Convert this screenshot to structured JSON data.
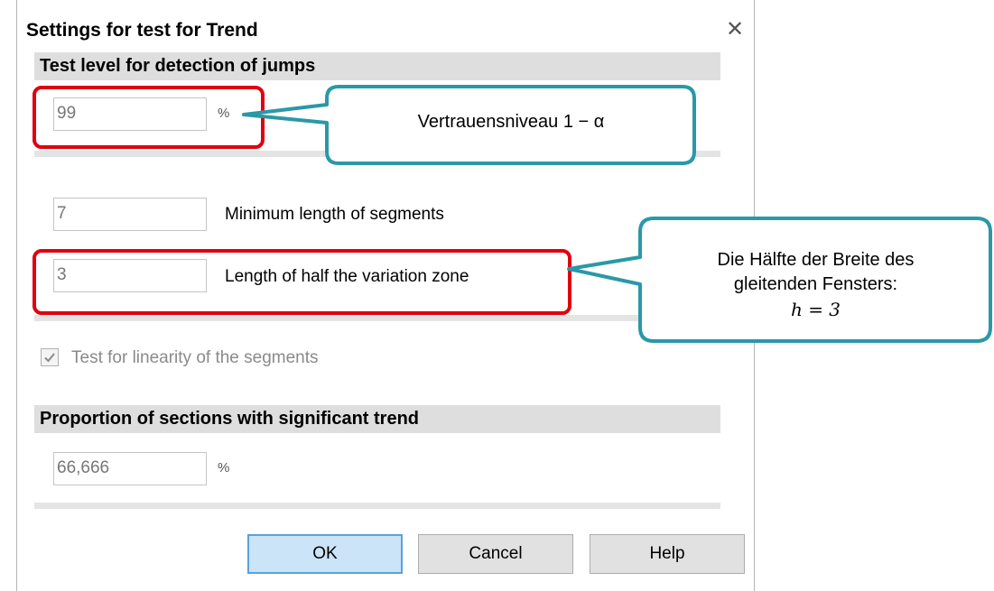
{
  "dialog": {
    "title": "Settings for test for Trend",
    "close_glyph": "✕"
  },
  "jump_section": {
    "header": "Test level for detection of jumps",
    "level_value": "99",
    "level_unit": "%"
  },
  "segments": {
    "min_length_value": "7",
    "min_length_label": "Minimum length of segments",
    "half_zone_value": "3",
    "half_zone_label": "Length of half the variation zone"
  },
  "linearity": {
    "label": "Test for linearity of the segments",
    "checked": true
  },
  "trend_section": {
    "header": "Proportion of sections with significant trend",
    "proportion_value": "66,666",
    "proportion_unit": "%"
  },
  "buttons": {
    "ok": "OK",
    "cancel": "Cancel",
    "help": "Help"
  },
  "callouts": {
    "confidence": "Vertrauensniveau 1 − α",
    "window_line1": "Die Hälfte der Breite des",
    "window_line2": "gleitenden Fensters:",
    "window_line3": "h = 3"
  },
  "colors": {
    "highlight_red": "#e0000f",
    "callout_border": "#2a98a8",
    "ok_button": "#cce4f7"
  }
}
